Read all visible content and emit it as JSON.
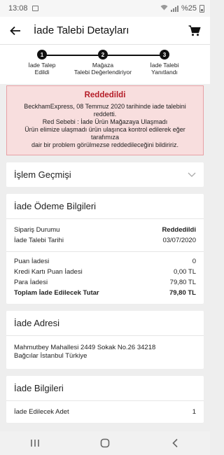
{
  "status_bar": {
    "time": "13:08",
    "battery": "%25"
  },
  "header": {
    "title": "İade Talebi Detayları"
  },
  "stepper": [
    {
      "num": "1",
      "line1": "İade Talep",
      "line2": "Edildi"
    },
    {
      "num": "2",
      "line1": "Mağaza",
      "line2": "Talebi Değerlendiriyor"
    },
    {
      "num": "3",
      "line1": "İade Talebi",
      "line2": "Yanıtlandı"
    }
  ],
  "alert": {
    "title": "Reddedildi",
    "lines": [
      "BeckhamExpress, 08 Temmuz 2020 tarihinde iade talebini",
      "reddetti.",
      "Red Sebebi : İade Ürün Mağazaya Ulaşmadı",
      "Ürün elimize ulaşmadı ürün ulaşınca kontrol edilerek eğer",
      "tarafımıza",
      "dair bir problem görülmezse reddedileceğini bildiririz."
    ]
  },
  "history": {
    "title": "İşlem Geçmişi"
  },
  "payment": {
    "title": "İade Ödeme Bilgileri",
    "order_status_label": "Sipariş Durumu",
    "order_status_value": "Reddedildi",
    "request_date_label": "İade Talebi Tarihi",
    "request_date_value": "03/07/2020",
    "points_label": "Puan İadesi",
    "points_value": "0",
    "cc_points_label": "Kredi Kartı Puan İadesi",
    "cc_points_value": "0,00 TL",
    "money_label": "Para İadesi",
    "money_value": "79,80 TL",
    "total_label": "Toplam İade Edilecek Tutar",
    "total_value": "79,80 TL"
  },
  "address": {
    "title": "İade Adresi",
    "line1": "Mahmutbey Mahallesi 2449 Sokak No.26 34218",
    "line2": "Bağcılar İstanbul Türkiye"
  },
  "info": {
    "title": "İade Bilgileri",
    "qty_label": "İade Edilecek Adet",
    "qty_value": "1"
  }
}
